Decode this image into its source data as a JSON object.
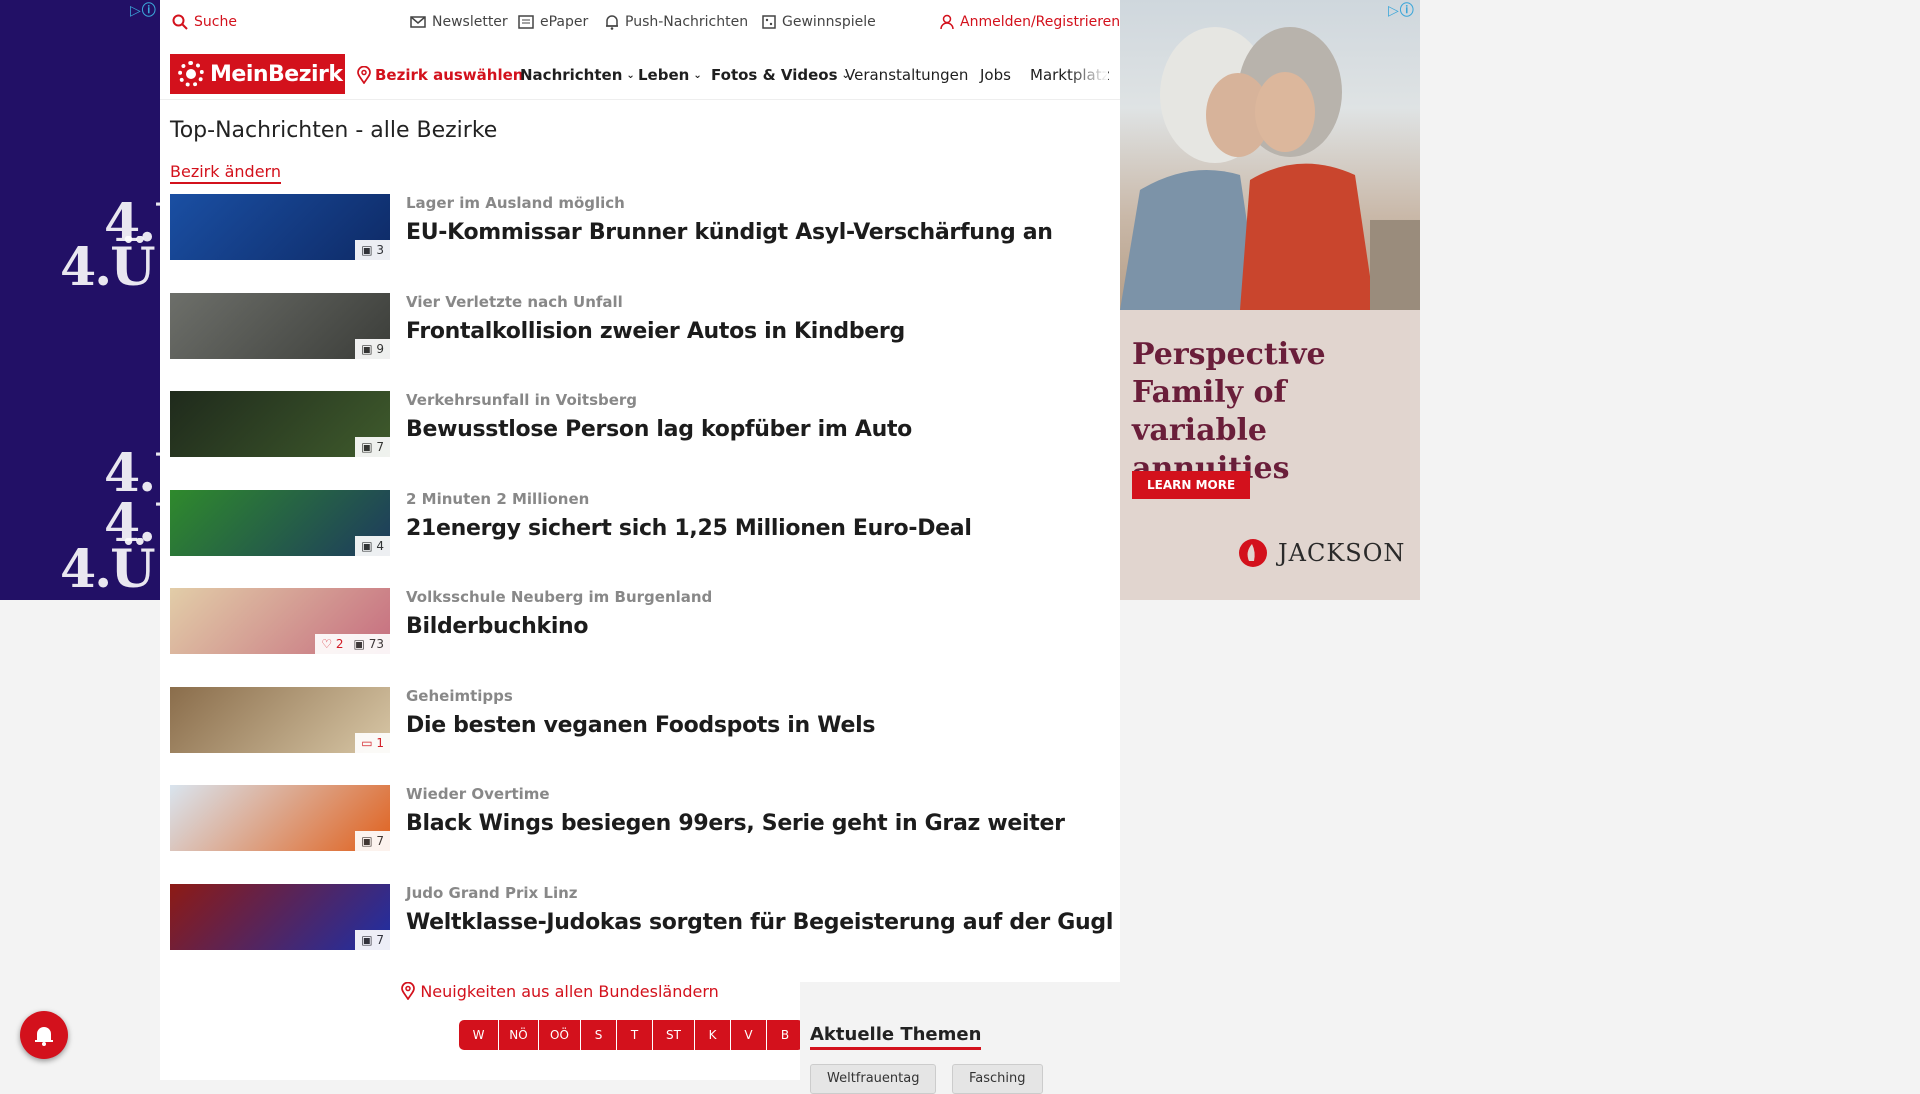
{
  "util": {
    "search": "Suche",
    "newsletter": "Newsletter",
    "epaper": "ePaper",
    "push": "Push-Nachrichten",
    "games": "Gewinnspiele",
    "login": "Anmelden/Registrieren"
  },
  "nav": {
    "logo": "MeinBezirk",
    "select_district": "Bezirk auswählen",
    "items": [
      "Nachrichten",
      "Leben",
      "Fotos & Videos",
      "Veranstaltungen",
      "Jobs",
      "Marktplatz"
    ]
  },
  "main": {
    "title": "Top-Nachrichten - alle Bezirke",
    "change_district": "Bezirk ändern",
    "articles": [
      {
        "kicker": "Lager im Ausland möglich",
        "headline": "EU-Kommissar Brunner kündigt Asyl-Verschärfung an",
        "photos": "3",
        "likes": "",
        "comments": ""
      },
      {
        "kicker": "Vier Verletzte nach Unfall",
        "headline": "Frontalkollision zweier Autos in Kindberg",
        "photos": "9",
        "likes": "",
        "comments": ""
      },
      {
        "kicker": "Verkehrsunfall in Voitsberg",
        "headline": "Bewusstlose Person lag kopfüber im Auto",
        "photos": "7",
        "likes": "",
        "comments": ""
      },
      {
        "kicker": "2 Minuten 2 Millionen",
        "headline": "21energy sichert sich 1,25 Millionen Euro-Deal",
        "photos": "4",
        "likes": "",
        "comments": ""
      },
      {
        "kicker": "Volksschule Neuberg im Burgenland",
        "headline": "Bilderbuchkino",
        "photos": "73",
        "likes": "2",
        "comments": ""
      },
      {
        "kicker": "Geheimtipps",
        "headline": "Die besten veganen Foodspots in Wels",
        "photos": "",
        "likes": "",
        "comments": "1"
      },
      {
        "kicker": "Wieder Overtime",
        "headline": "Black Wings besiegen 99ers, Serie geht in Graz weiter",
        "photos": "7",
        "likes": "",
        "comments": ""
      },
      {
        "kicker": "Judo Grand Prix Linz",
        "headline": "Weltklasse-Judokas sorgten für Begeisterung auf der Gugl",
        "photos": "7",
        "likes": "",
        "comments": ""
      }
    ]
  },
  "bundeslaender": {
    "title": "Neuigkeiten aus allen Bundesländern",
    "states": [
      "W",
      "NÖ",
      "OÖ",
      "S",
      "T",
      "ST",
      "K",
      "V",
      "B"
    ]
  },
  "themes": {
    "title": "Aktuelle Themen",
    "chips": [
      "Weltfrauentag",
      "Fasching"
    ]
  },
  "ads": {
    "left_text": "4.Ü",
    "right_tagline": "Perspective Family of variable annuities",
    "right_cta": "LEARN MORE",
    "right_brand": "JACKSON"
  },
  "colors": {
    "brand": "#d3111c",
    "left_ad_bg": "#221066"
  }
}
